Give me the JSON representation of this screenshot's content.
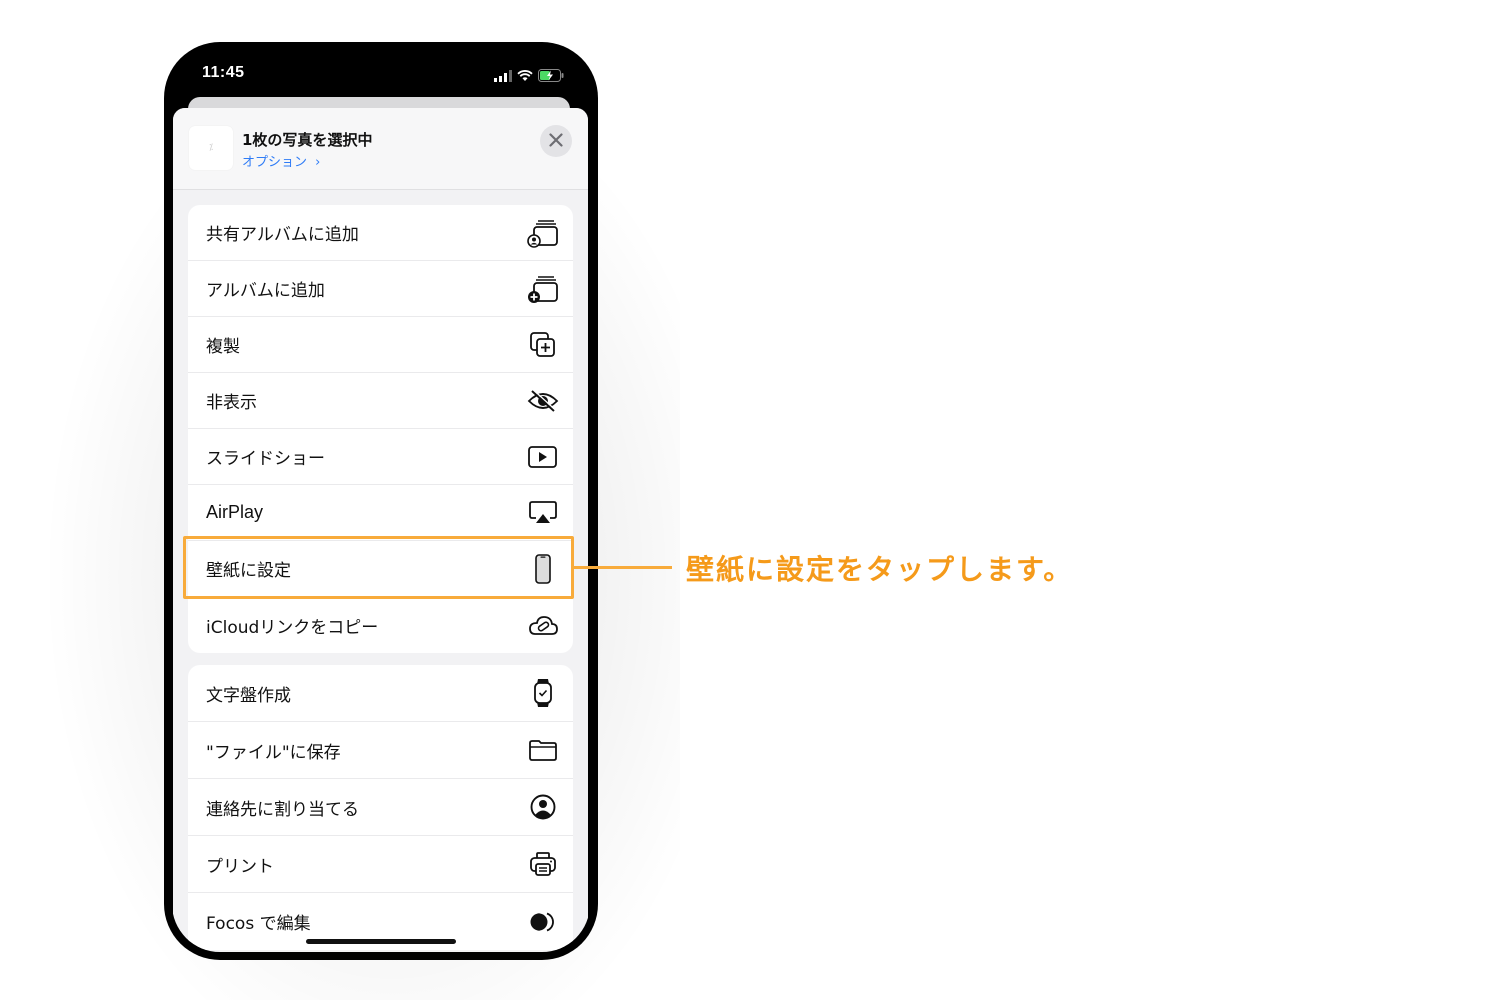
{
  "status_bar": {
    "time": "11:45",
    "icons": [
      "cellular-signal-icon",
      "wifi-icon",
      "battery-charging-icon"
    ]
  },
  "share_sheet": {
    "title": "1枚の写真を選択中",
    "options_label": "オプション",
    "options_chevron": "›",
    "close_icon": "close-icon",
    "groups": [
      {
        "items": [
          {
            "label": "共有アルバムに追加",
            "icon": "shared-album-icon"
          },
          {
            "label": "アルバムに追加",
            "icon": "add-album-icon"
          },
          {
            "label": "複製",
            "icon": "duplicate-icon"
          },
          {
            "label": "非表示",
            "icon": "eye-slash-icon"
          },
          {
            "label": "スライドショー",
            "icon": "play-rectangle-icon"
          },
          {
            "label": "AirPlay",
            "icon": "airplay-icon"
          },
          {
            "label": "壁紙に設定",
            "icon": "iphone-icon"
          },
          {
            "label": "iCloudリンクをコピー",
            "icon": "cloud-link-icon"
          }
        ]
      },
      {
        "items": [
          {
            "label": "文字盤作成",
            "icon": "watch-icon"
          },
          {
            "label": "\"ファイル\"に保存",
            "icon": "folder-icon"
          },
          {
            "label": "連絡先に割り当てる",
            "icon": "person-circle-icon"
          },
          {
            "label": "プリント",
            "icon": "printer-icon"
          },
          {
            "label": "Focos で編集",
            "icon": "focos-icon"
          }
        ]
      }
    ]
  },
  "annotation": {
    "text": "壁紙に設定をタップします。",
    "highlighted_item": "壁紙に設定",
    "color": "#f8ab3b"
  }
}
